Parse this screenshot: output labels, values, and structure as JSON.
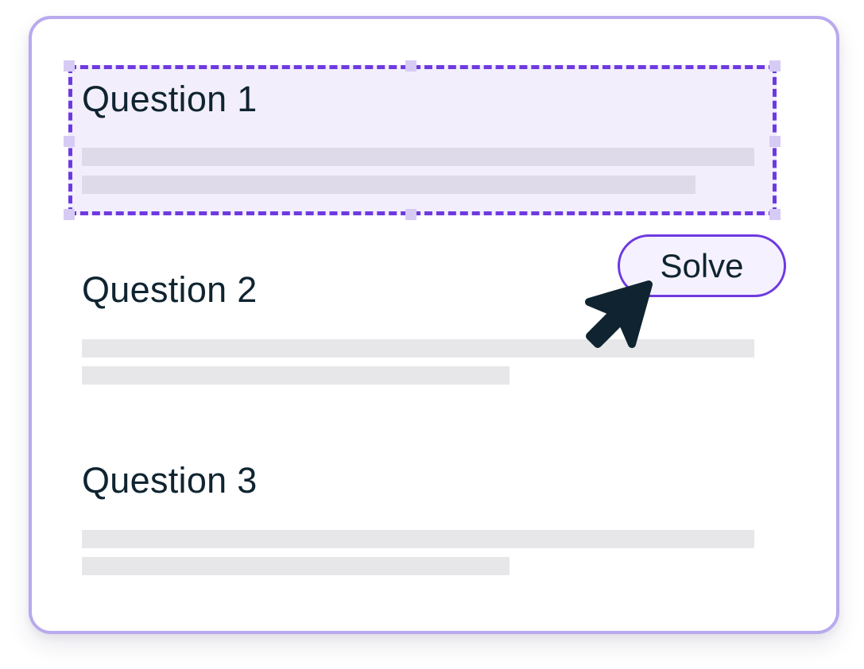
{
  "questions": [
    {
      "label": "Question 1",
      "selected": true
    },
    {
      "label": "Question 2",
      "selected": false
    },
    {
      "label": "Question 3",
      "selected": false
    }
  ],
  "solve_button": {
    "label": "Solve"
  },
  "colors": {
    "card_border": "#b9a9ee",
    "selection_border": "#6e3ae0",
    "selection_fill": "#f2eefc",
    "text": "#0f2430",
    "placeholder": "#e7e7ea",
    "cursor": "#0f2430"
  },
  "cursor_icon": "arrow-cursor-icon"
}
